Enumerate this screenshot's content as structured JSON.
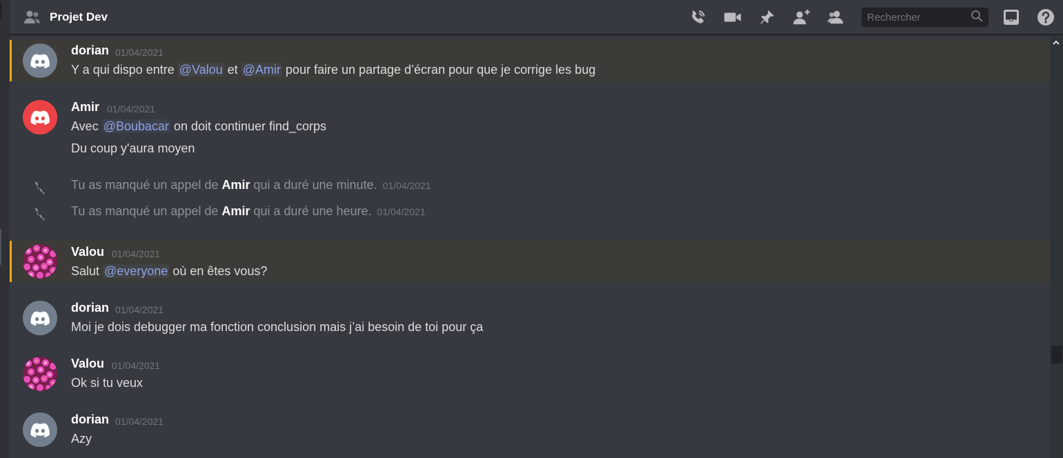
{
  "header": {
    "title": "Projet Dev",
    "icons": [
      "members-channel-icon",
      "call-icon",
      "video-icon",
      "pin-icon",
      "add-member-icon",
      "members-icon",
      "inbox-icon",
      "help-icon"
    ],
    "search_placeholder": "Rechercher"
  },
  "messages": [
    {
      "username": "dorian",
      "timestamp": "01/04/2021",
      "avatar": "discord-default-gray",
      "highlight": true,
      "parts": [
        "Y a qui dispo entre ",
        "@Valou",
        " et ",
        "@Amir",
        " pour faire un partage d’écran pour que je corrige les bug"
      ]
    },
    {
      "username": "Amir",
      "timestamp": "01/04/2021",
      "avatar": "discord-default-red",
      "line1_parts": [
        "Avec ",
        "@Boubacar",
        " on doit continuer find_corps"
      ],
      "line2": "Du coup y'aura moyen"
    },
    {
      "username": "Valou",
      "timestamp": "01/04/2021",
      "avatar": "flowers-photo",
      "highlight": true,
      "parts": [
        "Salut ",
        "@everyone",
        " où en êtes vous?"
      ]
    },
    {
      "username": "dorian",
      "timestamp": "01/04/2021",
      "avatar": "discord-default-gray",
      "text": "Moi je dois debugger ma fonction conclusion mais j’ai besoin de toi pour ça"
    },
    {
      "username": "Valou",
      "timestamp": "01/04/2021",
      "avatar": "flowers-photo",
      "text": "Ok si tu veux"
    },
    {
      "username": "dorian",
      "timestamp": "01/04/2021",
      "avatar": "discord-default-gray",
      "text": "Azy"
    }
  ],
  "system_messages": [
    {
      "prefix": "Tu as manqué un appel de ",
      "user": "Amir",
      "suffix": " qui a duré une minute.",
      "timestamp": "01/04/2021"
    },
    {
      "prefix": "Tu as manqué un appel de ",
      "user": "Amir",
      "suffix": " qui a duré une heure.",
      "timestamp": "01/04/2021"
    }
  ],
  "colors": {
    "background": "#36393f",
    "highlight_bg": "#3c3b37",
    "highlight_border": "#faa61a",
    "mention": "#8ea1e1",
    "avatar_gray": "#747f8d",
    "avatar_red": "#ed4245"
  }
}
